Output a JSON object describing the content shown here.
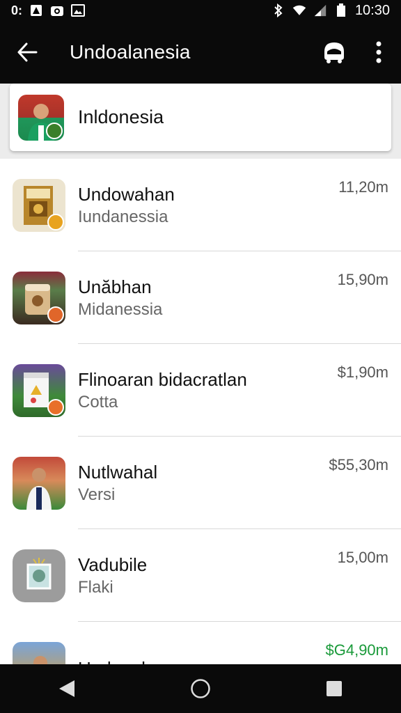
{
  "status_bar": {
    "time_left": "0:",
    "clock": "10:30",
    "icons": [
      "alert-icon",
      "camera-icon",
      "gallery-icon",
      "bluetooth-icon",
      "wifi-icon",
      "signal-icon",
      "battery-icon"
    ]
  },
  "app_bar": {
    "title": "Undoalanesia",
    "actions": [
      "cart-icon",
      "more-vert-icon"
    ]
  },
  "header": {
    "title": "Inldonesia",
    "thumb_icon": "person-icon"
  },
  "items": [
    {
      "title": "Undowahan",
      "subtitle": "Iundanessia",
      "price": "11,20m",
      "thumb": "book-icon",
      "price_color": "#555555"
    },
    {
      "title": "Unăbhan",
      "subtitle": "Midanessia",
      "price": "15,90m",
      "thumb": "coffee-icon",
      "price_color": "#555555"
    },
    {
      "title": "Flinoaran bidacratlan",
      "subtitle": "Cotta",
      "price": "$1,90m",
      "thumb": "product-box-icon",
      "price_color": "#555555"
    },
    {
      "title": "Nutlwahal",
      "subtitle": "Versi",
      "price": "$55,30m",
      "thumb": "person-icon",
      "price_color": "#555555"
    },
    {
      "title": "Vadubile",
      "subtitle": "Flaki",
      "price": "15,00m",
      "thumb": "frame-icon",
      "price_color": "#555555"
    },
    {
      "title": "Undonahas",
      "subtitle": "",
      "price": "$G4,90m",
      "thumb": "person-icon",
      "price_color": "#1a9a3a"
    }
  ],
  "nav_bar": {
    "buttons": [
      "back-triangle-icon",
      "home-circle-icon",
      "recents-square-icon"
    ]
  }
}
